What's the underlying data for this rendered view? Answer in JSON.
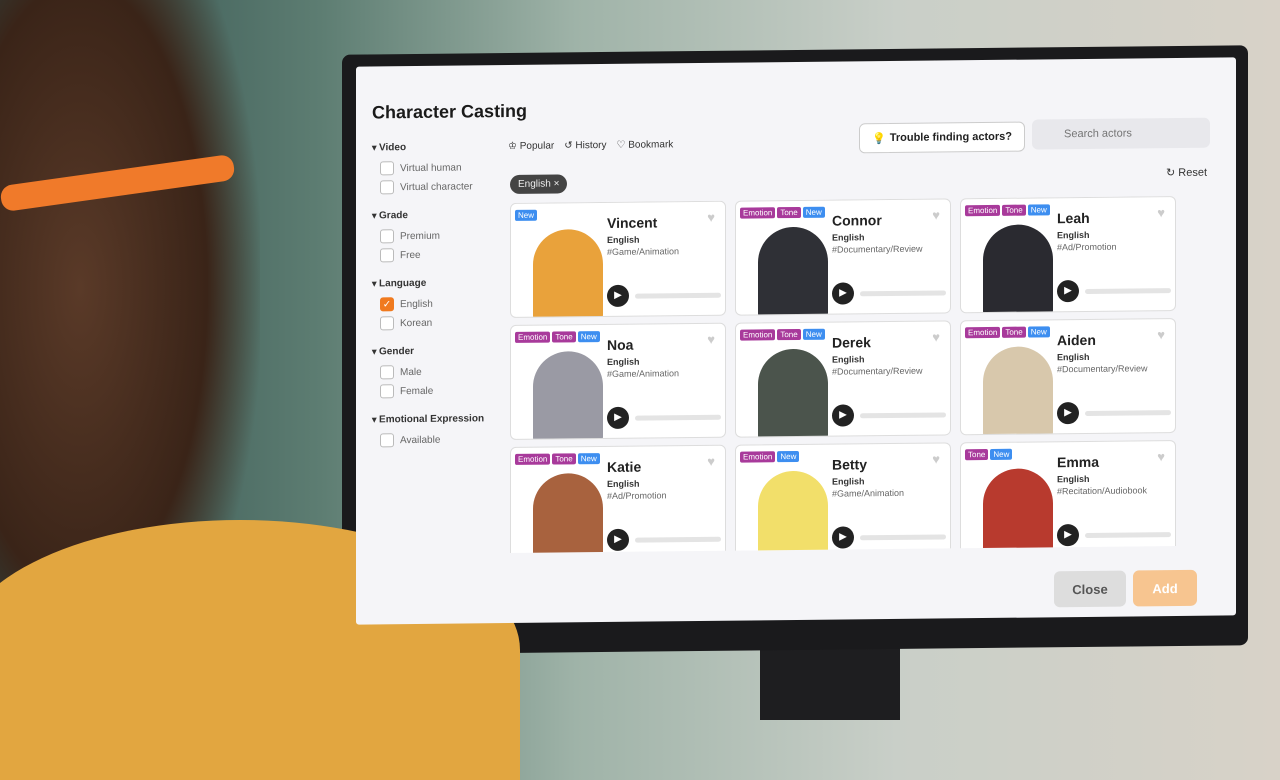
{
  "dialog": {
    "title": "Character Casting"
  },
  "filters": [
    {
      "label": "Video",
      "options": [
        {
          "label": "Virtual human",
          "checked": false
        },
        {
          "label": "Virtual character",
          "checked": false
        }
      ]
    },
    {
      "label": "Grade",
      "options": [
        {
          "label": "Premium",
          "checked": false
        },
        {
          "label": "Free",
          "checked": false
        }
      ]
    },
    {
      "label": "Language",
      "options": [
        {
          "label": "English",
          "checked": true
        },
        {
          "label": "Korean",
          "checked": false
        }
      ]
    },
    {
      "label": "Gender",
      "options": [
        {
          "label": "Male",
          "checked": false
        },
        {
          "label": "Female",
          "checked": false
        }
      ]
    },
    {
      "label": "Emotional Expression",
      "options": [
        {
          "label": "Available",
          "checked": false
        }
      ]
    }
  ],
  "tabs": [
    {
      "label": "Popular",
      "icon": "crown-icon"
    },
    {
      "label": "History",
      "icon": "history-icon"
    },
    {
      "label": "Bookmark",
      "icon": "heart-icon"
    }
  ],
  "trouble_label": "Trouble finding actors?",
  "search": {
    "placeholder": "Search actors"
  },
  "active_chip": "English ×",
  "reset_label": "Reset",
  "actors": [
    {
      "name": "Vincent",
      "lang": "English",
      "tag": "#Game/Animation",
      "badges": [
        "New"
      ],
      "color": "#e9a23b"
    },
    {
      "name": "Connor",
      "lang": "English",
      "tag": "#Documentary/Review",
      "badges": [
        "Emotion",
        "Tone",
        "New"
      ],
      "color": "#2f3036"
    },
    {
      "name": "Leah",
      "lang": "English",
      "tag": "#Ad/Promotion",
      "badges": [
        "Emotion",
        "Tone",
        "New"
      ],
      "color": "#2a2a30"
    },
    {
      "name": "Noa",
      "lang": "English",
      "tag": "#Game/Animation",
      "badges": [
        "Emotion",
        "Tone",
        "New"
      ],
      "color": "#9a9aa4"
    },
    {
      "name": "Derek",
      "lang": "English",
      "tag": "#Documentary/Review",
      "badges": [
        "Emotion",
        "Tone",
        "New"
      ],
      "color": "#4b544c"
    },
    {
      "name": "Aiden",
      "lang": "English",
      "tag": "#Documentary/Review",
      "badges": [
        "Emotion",
        "Tone",
        "New"
      ],
      "color": "#d8c8ac"
    },
    {
      "name": "Katie",
      "lang": "English",
      "tag": "#Ad/Promotion",
      "badges": [
        "Emotion",
        "Tone",
        "New"
      ],
      "color": "#a8623e"
    },
    {
      "name": "Betty",
      "lang": "English",
      "tag": "#Game/Animation",
      "badges": [
        "Emotion",
        "New"
      ],
      "color": "#f2df6a"
    },
    {
      "name": "Emma",
      "lang": "English",
      "tag": "#Recitation/Audiobook",
      "badges": [
        "Tone",
        "New"
      ],
      "color": "#b83a2e"
    }
  ],
  "footer": {
    "close": "Close",
    "add": "Add"
  }
}
